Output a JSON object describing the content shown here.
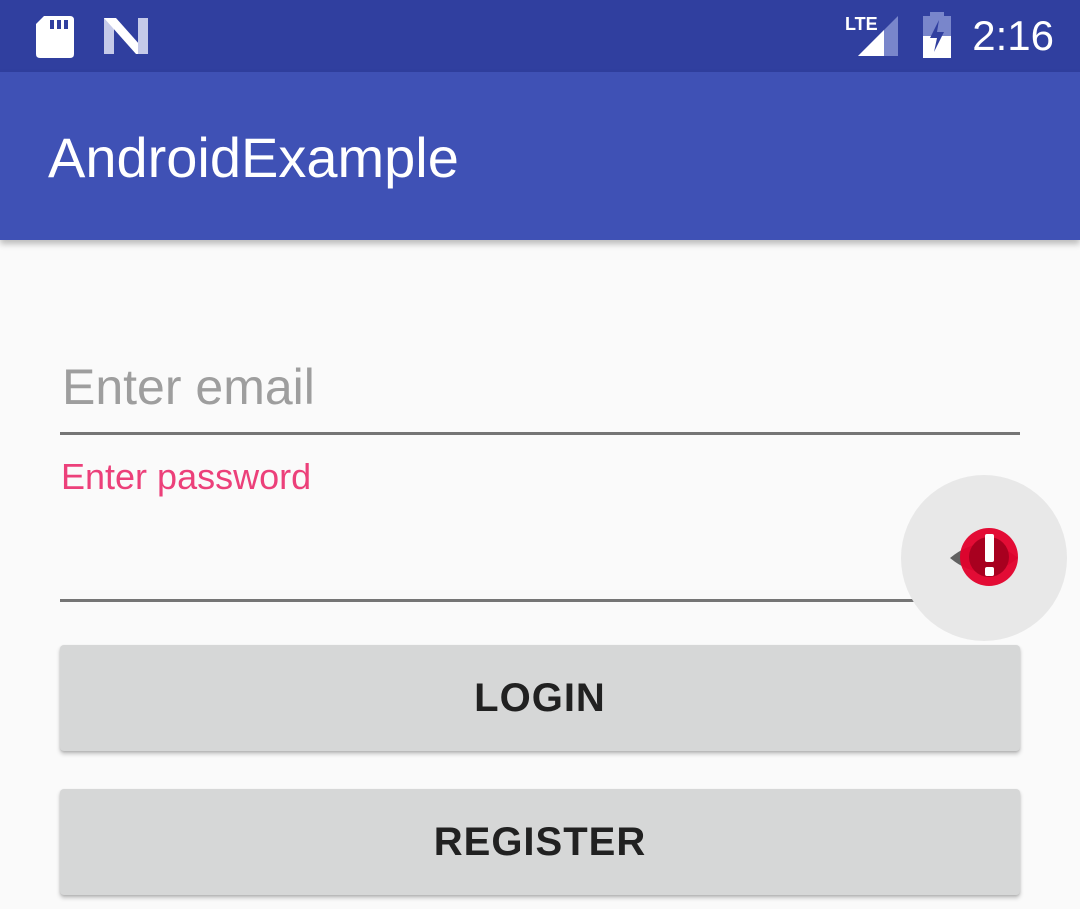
{
  "status_bar": {
    "time": "2:16",
    "network": "LTE",
    "icons": [
      "sd-card-icon",
      "android-n-icon",
      "lte-signal-icon",
      "battery-charging-icon"
    ]
  },
  "app_bar": {
    "title": "AndroidExample"
  },
  "form": {
    "email_placeholder": "Enter email",
    "password_label": "Enter password",
    "password_toggle_icon": "eye-icon"
  },
  "buttons": {
    "login": "LOGIN",
    "register": "REGISTER"
  },
  "colors": {
    "status_bar": "#303f9f",
    "app_bar": "#3f51b5",
    "accent": "#ec407a",
    "button": "#d6d7d7",
    "background": "#fafafa"
  }
}
